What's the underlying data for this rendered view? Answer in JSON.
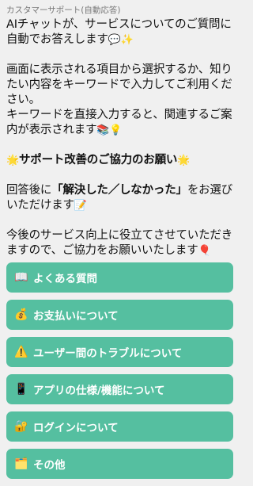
{
  "chat": {
    "sender": "カスタマーサポート(自動応答)",
    "p1": "AIチャットが、サービスについてのご質問に自動でお答えします",
    "p1_emoji": "💬✨",
    "p2a": "画面に表示される項目から選択するか、知りたい内容をキーワードで入力してご利用ください。",
    "p2b": "キーワードを直接入力すると、関連するご案内が表示されます",
    "p2b_emoji": "📚💡",
    "p3_emoji_left": "🌟",
    "p3": "サポート改善のご協力のお願い",
    "p3_emoji_right": "🌟",
    "p4_a": "回答後に",
    "p4_b": "「解決した／しなかった」",
    "p4_c": "をお選びいただけます",
    "p4_emoji": "📝",
    "p5": "今後のサービス向上に役立てさせていただきますので、ご協力をお願いいたします",
    "p5_emoji": "🎈"
  },
  "menu": [
    {
      "icon": "📖",
      "label": "よくある質問"
    },
    {
      "icon": "💰",
      "label": "お支払いについて"
    },
    {
      "icon": "⚠️",
      "label": "ユーザー間のトラブルについて"
    },
    {
      "icon": "📱",
      "label": "アプリの仕様/機能について"
    },
    {
      "icon": "🔐",
      "label": "ログインについて"
    },
    {
      "icon": "🗂️",
      "label": "その他"
    }
  ],
  "colors": {
    "button": "#55bfa0",
    "background": "#f0f0f0"
  }
}
